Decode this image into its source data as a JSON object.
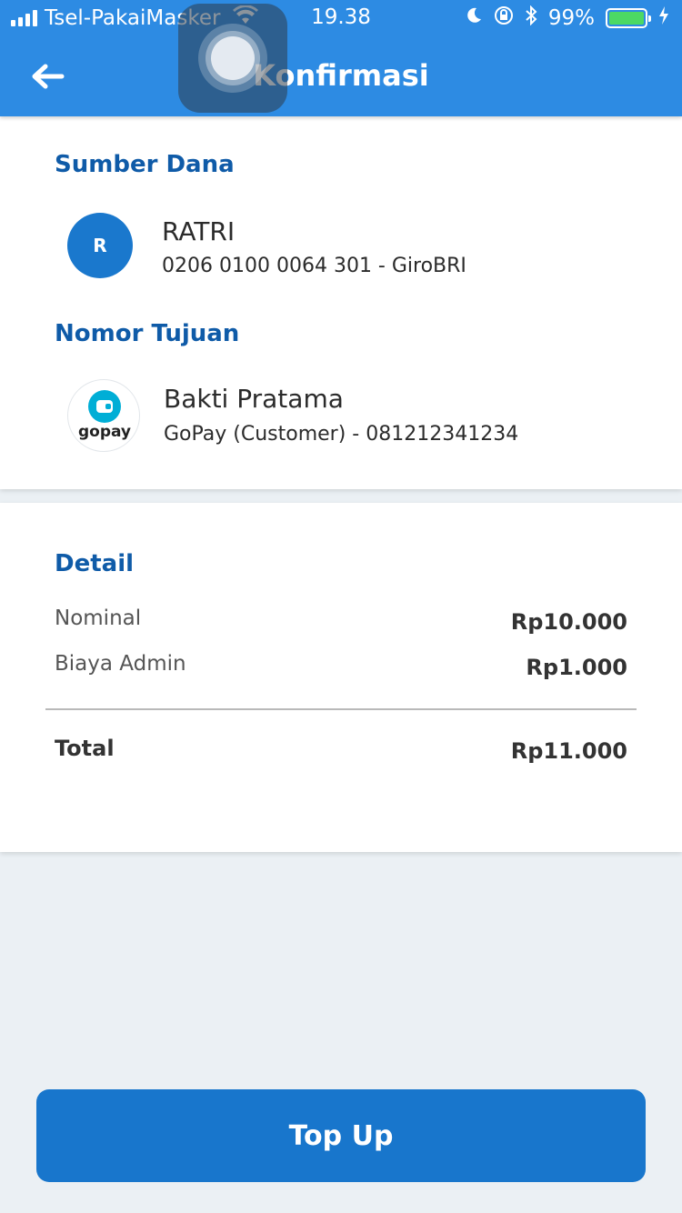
{
  "status_bar": {
    "carrier": "Tsel-PakaiMasker",
    "time": "19.38",
    "battery_percent": "99%",
    "battery_level": 0.99
  },
  "header": {
    "title": "Konfirmasi",
    "back_icon": "arrow-left-icon"
  },
  "source": {
    "section_title": "Sumber Dana",
    "avatar_initial": "R",
    "name": "RATRI",
    "account": "0206 0100 0064 301 - GiroBRI"
  },
  "destination": {
    "section_title": "Nomor Tujuan",
    "logo_text": "gopay",
    "name": "Bakti Pratama",
    "account": "GoPay (Customer) - 081212341234"
  },
  "detail": {
    "section_title": "Detail",
    "rows": [
      {
        "label": "Nominal",
        "value": "Rp10.000"
      },
      {
        "label": "Biaya Admin",
        "value": "Rp1.000"
      }
    ],
    "total_label": "Total",
    "total_value": "Rp11.000"
  },
  "action": {
    "button_label": "Top Up"
  },
  "colors": {
    "header_bg": "#2d8be3",
    "accent_text": "#0f5ba8",
    "button_bg": "#1876cc",
    "page_bg": "#ebf0f4"
  }
}
